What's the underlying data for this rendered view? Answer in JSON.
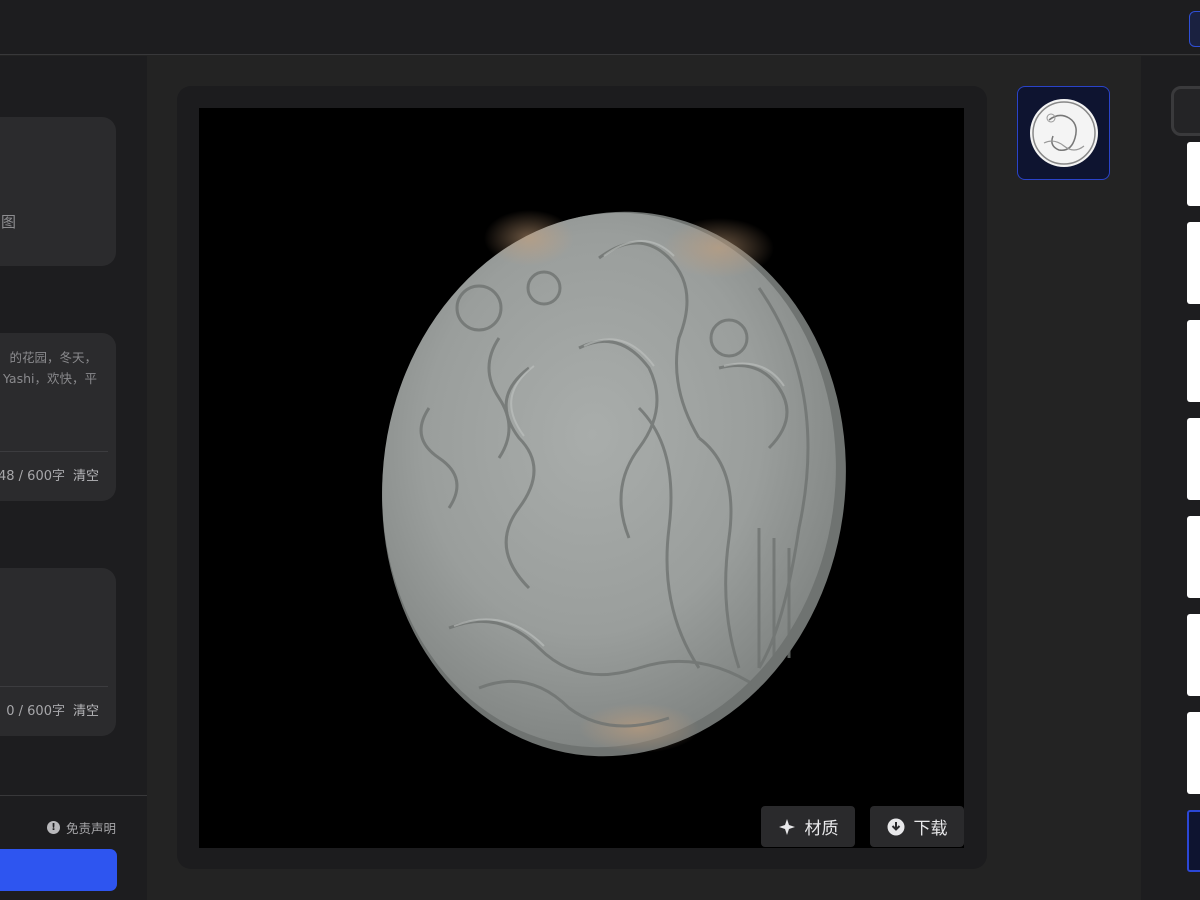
{
  "left_panel": {
    "card1_text": "图",
    "prompt": {
      "text_line1": "的花园，冬天，",
      "text_line2": "Yashi，欢快，平",
      "counter": "48 / 600字",
      "clear_label": "清空"
    },
    "negative_prompt": {
      "counter": "0 / 600字",
      "clear_label": "清空"
    },
    "disclaimer": "免责声明",
    "disclaimer_icon": "!"
  },
  "viewer": {
    "material_button": "材质",
    "download_button": "下载"
  },
  "colors": {
    "accent": "#2e55f0",
    "selected_border": "#2a43c9",
    "background": "#232323",
    "panel": "#1d1d1f"
  }
}
